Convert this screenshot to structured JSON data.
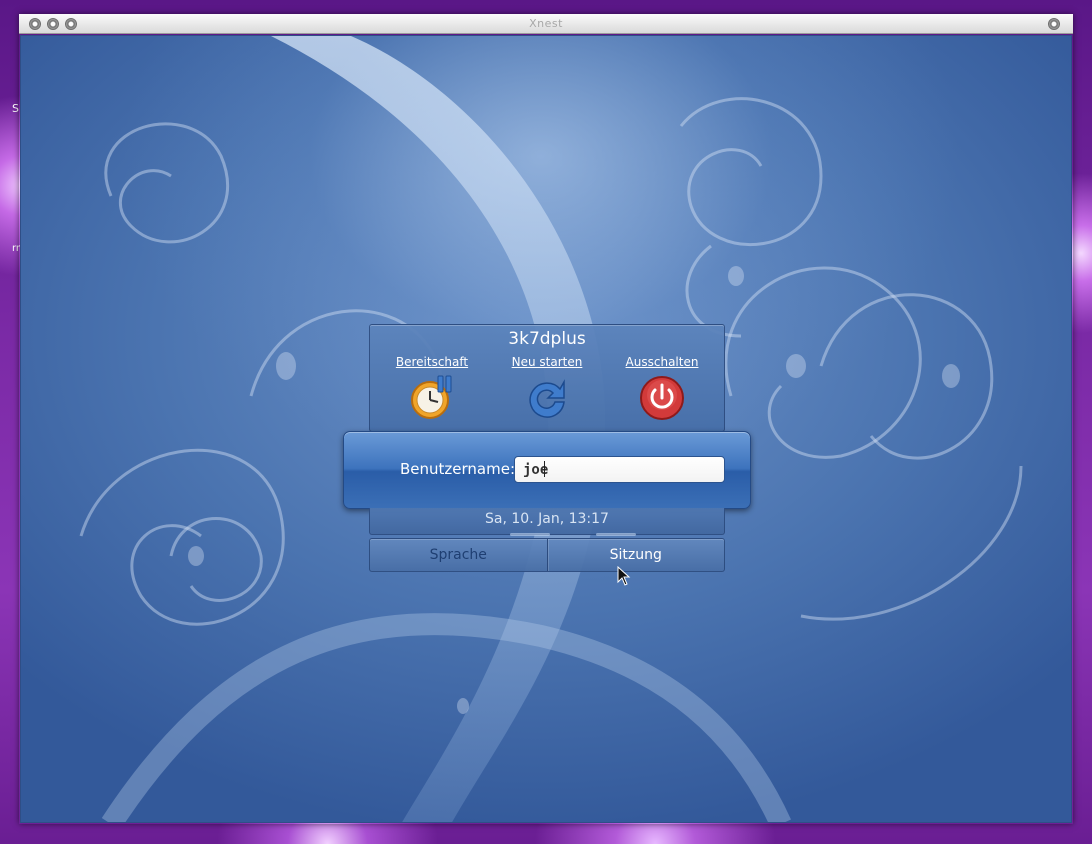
{
  "desktop": {
    "left_letters": [
      "S",
      "rr"
    ]
  },
  "window": {
    "title": "Xnest"
  },
  "greeter": {
    "hostname": "3k7dplus",
    "actions": [
      {
        "label": "Bereitschaft",
        "icon": "standby-clock-icon",
        "accent": "#f0a52a"
      },
      {
        "label": "Neu starten",
        "icon": "restart-arrow-icon",
        "accent": "#3f7ccc"
      },
      {
        "label": "Ausschalten",
        "icon": "power-icon",
        "accent": "#d23a3a"
      }
    ],
    "username_label": "Benutzername:",
    "username_value": "joe",
    "datetime": "Sa, 10. Jan, 13:17",
    "buttons": {
      "language": "Sprache",
      "session": "Sitzung"
    }
  },
  "colors": {
    "background_blue": "#4b74b0",
    "panel_blue": "#3d73bd",
    "desktop_purple": "#7b2aa6"
  }
}
